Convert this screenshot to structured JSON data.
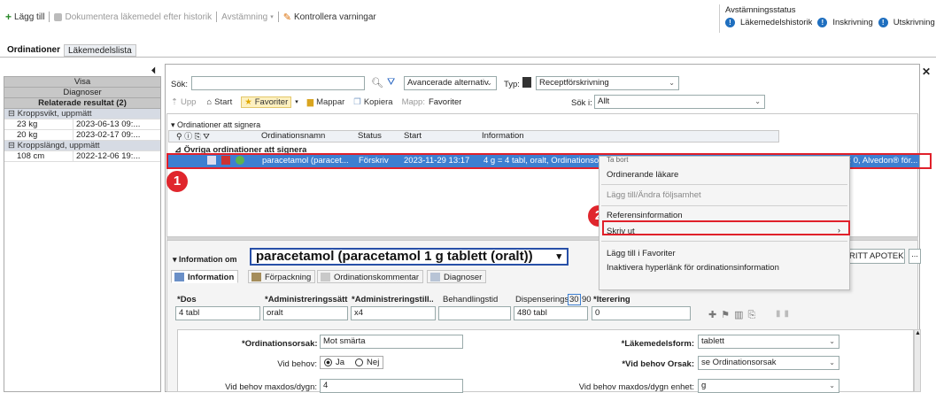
{
  "toolbar": {
    "add_label": "Lägg till",
    "document_label": "Dokumentera läkemedel efter historik",
    "reconcile_label": "Avstämning",
    "check_warnings_label": "Kontrollera varningar"
  },
  "status_box": {
    "title": "Avstämningsstatus",
    "items": [
      "Läkemedelshistorik",
      "Inskrivning",
      "Utskrivning"
    ]
  },
  "main_tabs": [
    "Ordinationer",
    "Läkemedelslista"
  ],
  "left_panel": {
    "headers": [
      "Visa",
      "Diagnoser",
      "Relaterade resultat (2)"
    ],
    "groups": [
      {
        "label": "Kroppsvikt, uppmätt",
        "rows": [
          {
            "value": "23 kg",
            "date": "2023-06-13 09:..."
          },
          {
            "value": "20 kg",
            "date": "2023-02-17 09:..."
          }
        ]
      },
      {
        "label": "Kroppslängd, uppmätt",
        "rows": [
          {
            "value": "108 cm",
            "date": "2022-12-06 19:..."
          }
        ]
      }
    ]
  },
  "search": {
    "label": "Sök:",
    "value": "",
    "advanced_label": "Avancerade alternativ",
    "type_label": "Typ:",
    "type_value": "Receptförskrivning",
    "search_in_label": "Sök i:",
    "search_in_value": "Allt"
  },
  "nav": {
    "up": "Upp",
    "start": "Start",
    "favorites": "Favoriter",
    "folders": "Mappar",
    "copy": "Kopiera",
    "folder_path_label": "Mapp:",
    "folder_path_value": "Favoriter"
  },
  "orders": {
    "section_title": "Ordinationer att signera",
    "columns": [
      "Ordinationsnamn",
      "Status",
      "Start",
      "Information"
    ],
    "group_label": "Övriga ordinationer att signera",
    "row": {
      "name": "paracetamol (paracet...",
      "status": "Förskriv",
      "start": "2023-11-29 13:17",
      "info": "4 g = 4 tabl, oralt, Ordinationsorsak: Mot smärta, x4, tablett, Vid behov maxdos/dygn: 4 g, Itarering: 0, Alvedon® för..."
    }
  },
  "context_menu": {
    "items": [
      {
        "label": "Ta bort",
        "disabled": false
      },
      {
        "label": "Ordinerande läkare",
        "disabled": false
      },
      {
        "label": "Lägg till/Ändra följsamhet",
        "disabled": true
      },
      {
        "label": "Referensinformation",
        "disabled": false
      },
      {
        "label": "Skriv ut",
        "disabled": false,
        "submenu": true
      },
      {
        "label": "Lägg till i Favoriter",
        "disabled": false
      },
      {
        "label": "Inaktivera hyperlänk för ordinationsinformation",
        "disabled": false
      }
    ]
  },
  "badges": [
    "1",
    "2"
  ],
  "info_section": {
    "title": "Information om",
    "drug_name": "paracetamol (paracetamol 1 g tablett (oralt))",
    "pharmacy": "RITT APOTEK)",
    "more": "..."
  },
  "detail_tabs": [
    "Information",
    "Förpackning",
    "Ordinationskommentar",
    "Diagnoser"
  ],
  "dose_fields": {
    "labels": [
      "*Dos",
      "*Administreringssätt",
      "*Administreringstill...",
      "Behandlingstid",
      "Dispenserings",
      "30",
      "90",
      "*Iterering"
    ],
    "values": [
      "4 tabl",
      "oralt",
      "x4",
      "",
      "480 tabl",
      "0"
    ]
  },
  "form": {
    "reason_label": "*Ordinationsorsak:",
    "reason_value": "Mot smärta",
    "prn_label": "Vid behov:",
    "prn_yes": "Ja",
    "prn_no": "Nej",
    "maxdose_label": "Vid behov maxdos/dygn:",
    "maxdose_value": "4",
    "form_label": "*Läkemedelsform:",
    "form_value": "tablett",
    "prn_reason_label": "*Vid behov Orsak:",
    "prn_reason_value": "se Ordinationsorsak",
    "maxdose_unit_label": "Vid behov maxdos/dygn enhet:",
    "maxdose_unit_value": "g"
  }
}
